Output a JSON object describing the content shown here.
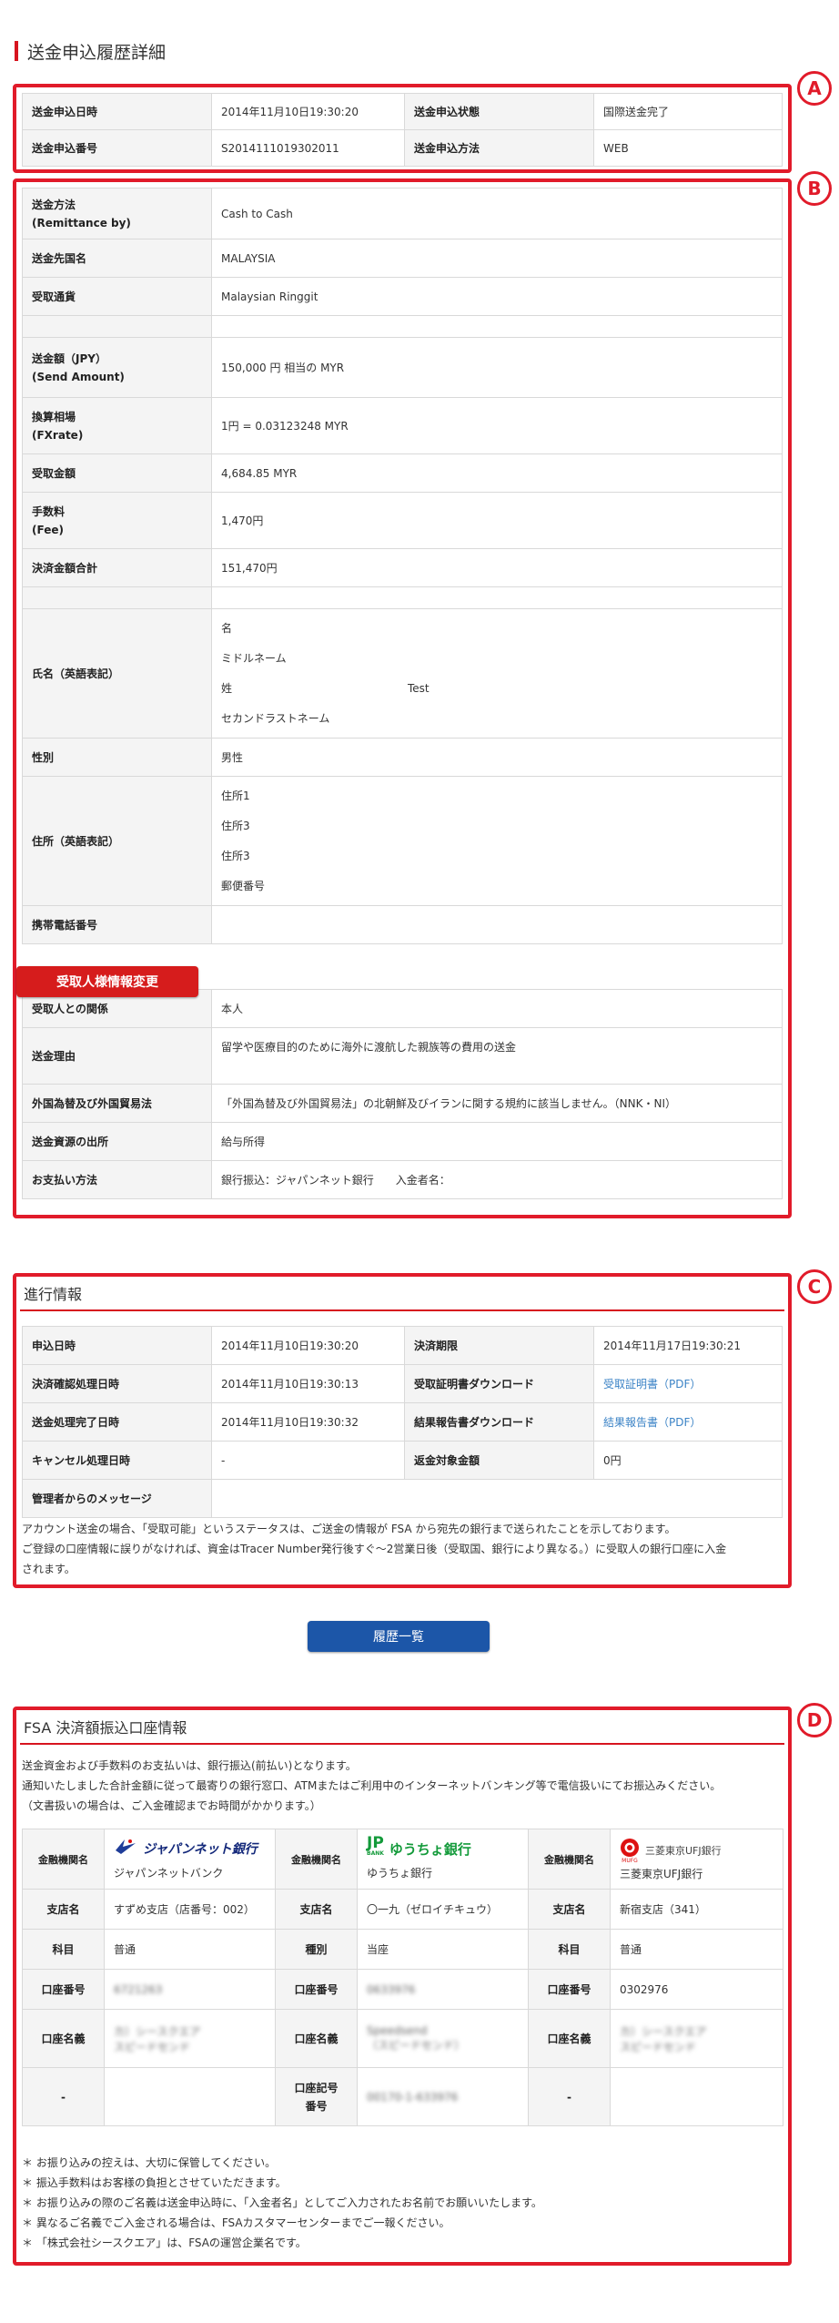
{
  "page_title": "送金申込履歴詳細",
  "markers": {
    "a": "A",
    "b": "B",
    "c": "C",
    "d": "D"
  },
  "summary": {
    "date_label": "送金申込日時",
    "date_value": "2014年11月10日19:30:20",
    "status_label": "送金申込状態",
    "status_value": "国際送金完了",
    "number_label": "送金申込番号",
    "number_value": "S2014111019302011",
    "method_label": "送金申込方法",
    "method_value": "WEB"
  },
  "details": {
    "remit_by_label_1": "送金方法",
    "remit_by_label_2": "(Remittance by)",
    "remit_by_value": "Cash to Cash",
    "country_label": "送金先国名",
    "country_value": "MALAYSIA",
    "currency_label": "受取通貨",
    "currency_value": "Malaysian Ringgit",
    "send_label_1": "送金額（JPY）",
    "send_label_2": "(Send Amount)",
    "send_value": "150,000 円 相当の MYR",
    "fx_label_1": "換算相場",
    "fx_label_2": "(FXrate)",
    "fx_value": "1円 = 0.03123248 MYR",
    "receive_label": "受取金額",
    "receive_value": "4,684.85 MYR",
    "fee_label_1": "手数料",
    "fee_label_2": "(Fee)",
    "fee_value": "1,470円",
    "total_label": "決済金額合計",
    "total_value": "151,470円",
    "name_label": "氏名（英語表記）",
    "name_first": "名",
    "name_middle": "ミドルネーム",
    "name_last": "姓",
    "name_last_value": "Test",
    "name_second": "セカンドラストネーム",
    "gender_label": "性別",
    "gender_value": "男性",
    "address_label": "住所（英語表記）",
    "address_1": "住所1",
    "address_2": "住所3",
    "address_3": "住所3",
    "address_zip": "郵便番号",
    "mobile_label": "携帯電話番号",
    "mobile_value": "",
    "change_button": "受取人様情報変更",
    "relation_label": "受取人との関係",
    "relation_value": "本人",
    "reason_label": "送金理由",
    "reason_value": "留学や医療目的のために海外に渡航した親族等の費用の送金",
    "fx_law_label": "外国為替及び外国貿易法",
    "fx_law_value": "「外国為替及び外国貿易法」の北朝鮮及びイランに関する規約に該当しません。（NNK・NI）",
    "source_label": "送金資源の出所",
    "source_value": "給与所得",
    "payment_label": "お支払い方法",
    "payment_value": "銀行振込：ジャパンネット銀行　　入金者名："
  },
  "progress": {
    "title": "進行情報",
    "apply_label": "申込日時",
    "apply_value": "2014年11月10日19:30:20",
    "deadline_label": "決済期限",
    "deadline_value": "2014年11月17日19:30:21",
    "confirm_label": "決済確認処理日時",
    "confirm_value": "2014年11月10日19:30:13",
    "receipt_label": "受取証明書ダウンロード",
    "receipt_value": "受取証明書（PDF）",
    "complete_label": "送金処理完了日時",
    "complete_value": "2014年11月10日19:30:32",
    "report_label": "結果報告書ダウンロード",
    "report_value": "結果報告書（PDF）",
    "cancel_label": "キャンセル処理日時",
    "cancel_value": "-",
    "refund_label": "返金対象金額",
    "refund_value": "0円",
    "message_label": "管理者からのメッセージ",
    "message_value": "",
    "note_1": "アカウント送金の場合、「受取可能」というステータスは、ご送金の情報が FSA から宛先の銀行まで送られたことを示しております。",
    "note_2": "ご登録の口座情報に誤りがなければ、資金はTracer Number発行後すぐ〜2営業日後（受取国、銀行により異なる。）に受取人の銀行口座に入金",
    "note_3": "されます。"
  },
  "history_button": "履歴一覧",
  "fsa": {
    "title": "FSA 決済額振込口座情報",
    "intro_1": "送金資金および手数料のお支払いは、銀行振込(前払い)となります。",
    "intro_2": "通知いたしました合計金額に従って最寄りの銀行窓口、ATMまたはご利用中のインターネットバンキング等で電信扱いにてお振込みください。",
    "intro_3": "（文書扱いの場合は、ご入金確認までお時間がかかります。）",
    "bank_label": "金融機関名",
    "branch_label": "支店名",
    "kind_label": "科目",
    "type_label": "種別",
    "account_label": "口座番号",
    "holder_label": "口座名義",
    "symbol_label_1": "口座記号",
    "symbol_label_2": "番号",
    "dash": "-",
    "bank1_logo": "ジャパンネット銀行",
    "bank1_name": "ジャパンネットバンク",
    "bank1_branch": "すずめ支店（店番号：002）",
    "bank1_kind": "普通",
    "bank1_account": "6721263",
    "bank1_holder_1": "カ）シースクエア",
    "bank1_holder_2": "スピードセンド",
    "bank2_logo": "ゆうちょ銀行",
    "bank2_logo_mark": "JP",
    "bank2_logo_sub": "BANK",
    "bank2_name": "ゆうちょ銀行",
    "bank2_branch": "〇一九（ゼロイチキュウ）",
    "bank2_type": "当座",
    "bank2_account": "0633976",
    "bank2_holder_1": "Speedsend",
    "bank2_holder_2": "（スピードセンド）",
    "bank2_symbol": "00170-1-633976",
    "bank3_logo": "三菱東京UFJ銀行",
    "bank3_logo_sub": "MUFG",
    "bank3_name": "三菱東京UFJ銀行",
    "bank3_branch": "新宿支店（341）",
    "bank3_kind": "普通",
    "bank3_account": "0302976",
    "bank3_holder_1": "カ）シースクエア",
    "bank3_holder_2": "スピードセンド",
    "foot_1": "＊ お振り込みの控えは、大切に保管してください。",
    "foot_2": "＊ 振込手数料はお客様の負担とさせていただきます。",
    "foot_3": "＊ お振り込みの際のご名義は送金申込時に、「入金者名」としてご入力されたお名前でお願いいたします。",
    "foot_4": "＊ 異なるご名義でご入金される場合は、FSAカスタマーセンターまでご一報ください。",
    "foot_5": "＊ 「株式会社シースクエア」は、FSAの運営企業名です。"
  }
}
